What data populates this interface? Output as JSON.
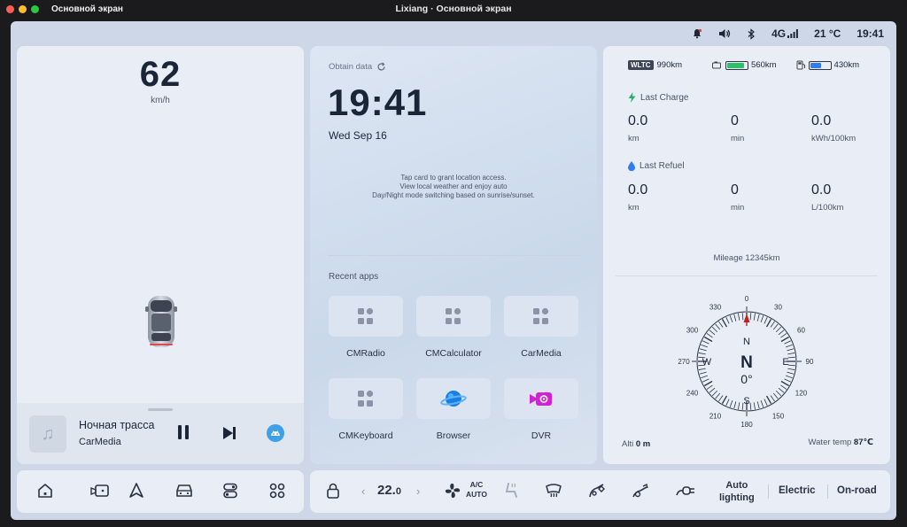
{
  "window": {
    "left_label": "Основной экран",
    "title": "Lixiang · Основной экран"
  },
  "status": {
    "network": "4G",
    "temperature": "21 °C",
    "time": "19:41"
  },
  "speed": {
    "value": "62",
    "unit": "km/h"
  },
  "media": {
    "track": "Ночная трасса",
    "source": "CarMedia"
  },
  "clock": {
    "obtain": "Obtain data",
    "time": "19:41",
    "date": "Wed Sep 16",
    "hint1": "Tap card to grant location access.",
    "hint2": "View local weather and enjoy auto",
    "hint3": "Day/Night mode switching based on sunrise/sunset."
  },
  "recent": {
    "title": "Recent apps",
    "apps": [
      "CMRadio",
      "CMCalculator",
      "CarMedia",
      "CMKeyboard",
      "Browser",
      "DVR"
    ]
  },
  "ranges": {
    "wltc_badge": "WLTC",
    "wltc": "990km",
    "electric": "560km",
    "fuel": "430km",
    "electric_level": 0.85,
    "fuel_level": 0.55
  },
  "last_charge": {
    "title": "Last Charge",
    "v1": "0.0",
    "u1": "km",
    "v2": "0",
    "u2": "min",
    "v3": "0.0",
    "u3": "kWh/100km"
  },
  "last_refuel": {
    "title": "Last Refuel",
    "v1": "0.0",
    "u1": "km",
    "v2": "0",
    "u2": "min",
    "v3": "0.0",
    "u3": "L/100km"
  },
  "mileage": "Mileage   12345km",
  "compass": {
    "heading_letter": "N",
    "heading_deg": "0°",
    "ticks": [
      "0",
      "30",
      "60",
      "90",
      "120",
      "150",
      "180",
      "210",
      "240",
      "270",
      "300",
      "330"
    ],
    "cardinals": {
      "n": "N",
      "e": "E",
      "s": "S",
      "w": "W"
    }
  },
  "alti": {
    "label": "Alti",
    "value": "0 m"
  },
  "water": {
    "label": "Water temp",
    "value": "87℃"
  },
  "climate": {
    "temp": "22.",
    "temp_small": "0",
    "ac_top": "A/C",
    "ac_bottom": "AUTO"
  },
  "modes": {
    "lighting1": "Auto",
    "lighting2": "lighting",
    "drive": "Electric",
    "terrain": "On-road"
  }
}
